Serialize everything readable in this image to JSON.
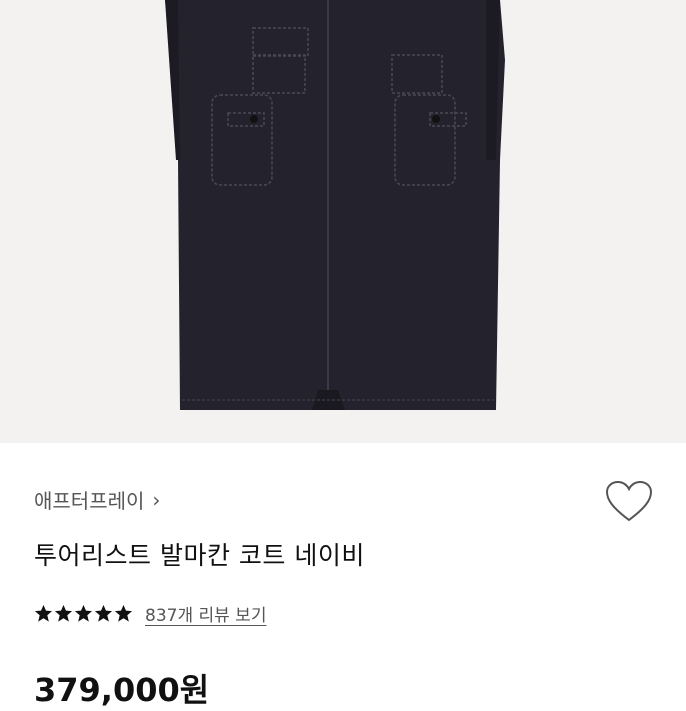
{
  "product": {
    "brand": "애프터프레이",
    "brand_chevron": "›",
    "name": "투어리스트 발마칸 코트 네이비",
    "rating_stars": 5,
    "review_link": "837개 리뷰 보기",
    "price": "379,000원"
  },
  "icons": {
    "wishlist": "heart-outline-icon",
    "star": "star-filled-icon"
  },
  "colors": {
    "coat": "#24232d",
    "background": "#f3f2f0"
  }
}
